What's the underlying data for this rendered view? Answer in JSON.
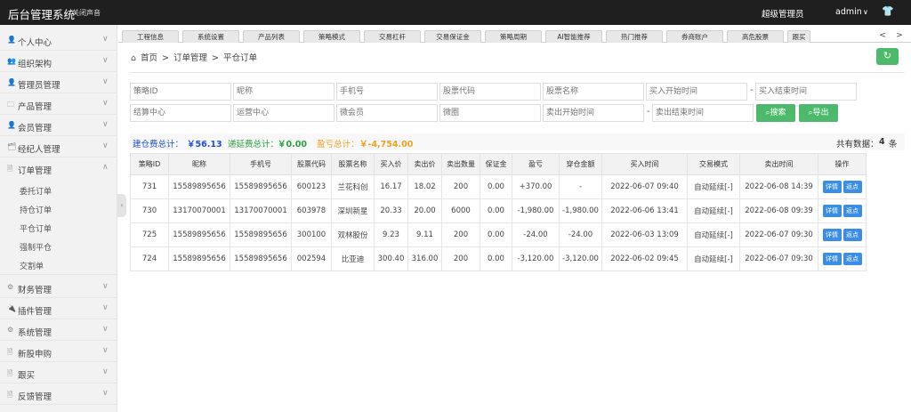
{
  "topbar": {
    "title": "后台管理系统",
    "sound": "关闭声音",
    "role": "超级管理员",
    "user": "admin",
    "caret": "∨",
    "shirt_icon": "👕"
  },
  "sidebar": {
    "items": [
      {
        "label": "个人中心",
        "icon": "👤"
      },
      {
        "label": "组织架构",
        "icon": "👥"
      },
      {
        "label": "管理员管理",
        "icon": "👤"
      },
      {
        "label": "产品管理",
        "icon": "🗀"
      },
      {
        "label": "会员管理",
        "icon": "👤"
      },
      {
        "label": "经纪人管理",
        "icon": "🗂"
      },
      {
        "label": "订单管理",
        "icon": "🗎"
      },
      {
        "label": "财务管理",
        "icon": "⚙"
      },
      {
        "label": "插件管理",
        "icon": "🔌"
      },
      {
        "label": "系统管理",
        "icon": "⚙"
      },
      {
        "label": "新股申购",
        "icon": "🗎"
      },
      {
        "label": "跟买",
        "icon": "🗎"
      },
      {
        "label": "反馈管理",
        "icon": "🗎"
      }
    ],
    "subitems": [
      "委托订单",
      "持仓订单",
      "平仓订单",
      "强制平仓",
      "交割单"
    ]
  },
  "tabs": [
    "工程信息",
    "系统设置",
    "产品列表",
    "策略模式",
    "交易杠杆",
    "交易保证金",
    "策略周期",
    "AI智能推荐",
    "热门推荐",
    "券商账户",
    "高危股票",
    "跟买"
  ],
  "breadcrumb": {
    "home": "首页",
    "sep": ">",
    "parent": "订单管理",
    "current": "平仓订单"
  },
  "filters": {
    "row1": [
      "策略ID",
      "昵称",
      "手机号",
      "股票代码",
      "股票名称",
      "买入开始时间",
      "买入结束时间"
    ],
    "row2": [
      "结算中心",
      "运营中心",
      "微会员",
      "微圈",
      "卖出开始时间",
      "卖出结束时间"
    ],
    "dash": "-",
    "search": "搜索",
    "export": "导出"
  },
  "summary": {
    "open_label": "建仓费总计：",
    "open_value": "￥56.13",
    "defer_label": "递延费总计：",
    "defer_value": "￥0.00",
    "pnl_label": "盈亏总计：",
    "pnl_value": "￥-4,754.00",
    "count_label": "共有数据：",
    "count_value": "4",
    "count_unit": "条"
  },
  "table": {
    "columns": [
      "策略ID",
      "昵称",
      "手机号",
      "股票代码",
      "股票名称",
      "买入价",
      "卖出价",
      "卖出数量",
      "保证金",
      "盈亏",
      "穿仓金额",
      "买入时间",
      "交易模式",
      "卖出时间",
      "操作"
    ],
    "detail_label": "详情",
    "rebate_label": "返点",
    "rows": [
      {
        "id": "731",
        "nickname": "15589895656",
        "phone": "15589895656",
        "code": "600123",
        "name": "兰花科创",
        "buy": "16.17",
        "sell": "18.02",
        "qty": "200",
        "margin": "0.00",
        "pnl": "+370.00",
        "pnl_color": "red",
        "breach": "-",
        "breach_color": "",
        "buy_time": "2022-06-07 09:40",
        "mode": "自动延续[-]",
        "sell_time": "2022-06-08 14:39"
      },
      {
        "id": "730",
        "nickname": "13170070001",
        "phone": "13170070001",
        "code": "603978",
        "name": "深圳新星",
        "buy": "20.33",
        "sell": "20.00",
        "qty": "6000",
        "margin": "0.00",
        "pnl": "-1,980.00",
        "pnl_color": "green",
        "breach": "-1,980.00",
        "breach_color": "green",
        "buy_time": "2022-06-06 13:41",
        "mode": "自动延续[-]",
        "sell_time": "2022-06-08 09:39"
      },
      {
        "id": "725",
        "nickname": "15589895656",
        "phone": "15589895656",
        "code": "300100",
        "name": "双林股份",
        "buy": "9.23",
        "sell": "9.11",
        "qty": "200",
        "margin": "0.00",
        "pnl": "-24.00",
        "pnl_color": "green",
        "breach": "-24.00",
        "breach_color": "green",
        "buy_time": "2022-06-03 13:09",
        "mode": "自动延续[-]",
        "sell_time": "2022-06-07 09:30"
      },
      {
        "id": "724",
        "nickname": "15589895656",
        "phone": "15589895656",
        "code": "002594",
        "name": "比亚迪",
        "buy": "300.40",
        "sell": "316.00",
        "qty": "200",
        "margin": "0.00",
        "pnl": "-3,120.00",
        "pnl_color": "green",
        "breach": "-3,120.00",
        "breach_color": "green",
        "buy_time": "2022-06-02 09:45",
        "mode": "自动延续[-]",
        "sell_time": "2022-06-07 09:30"
      }
    ]
  },
  "colors": {
    "topbar": "#1f1f1f",
    "accent_green": "#4cb96b",
    "blue": "#3a8ee6",
    "profit_red": "#e02020",
    "loss_green": "#2aa040",
    "fee_orange": "#f0a020",
    "fee_blue": "#1d4fd8"
  }
}
